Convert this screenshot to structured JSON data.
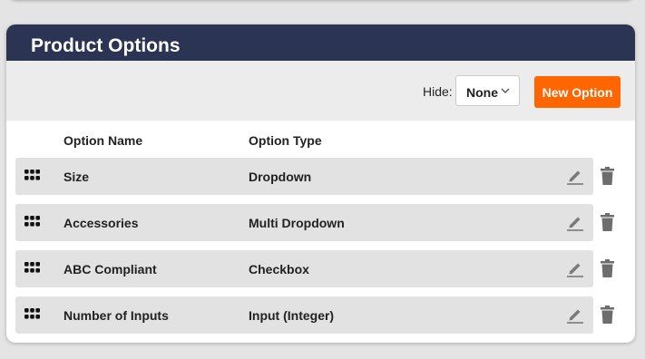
{
  "panel": {
    "title": "Product Options"
  },
  "toolbar": {
    "hide_label": "Hide:",
    "hide_value": "None",
    "new_option_label": "New Option"
  },
  "table": {
    "columns": [
      "Option Name",
      "Option Type"
    ],
    "rows": [
      {
        "name": "Size",
        "type": "Dropdown"
      },
      {
        "name": "Accessories",
        "type": "Multi Dropdown"
      },
      {
        "name": "ABC Compliant",
        "type": "Checkbox"
      },
      {
        "name": "Number of Inputs",
        "type": "Input (Integer)"
      }
    ]
  },
  "icons": {
    "drag": "grip-icon",
    "edit": "pencil-icon",
    "delete": "trash-icon",
    "select": "chevron-down-icon"
  },
  "colors": {
    "header_bg": "#2c3454",
    "accent": "#ff6600",
    "row_bg": "#e2e2e2",
    "toolbar_bg": "#ececec"
  }
}
